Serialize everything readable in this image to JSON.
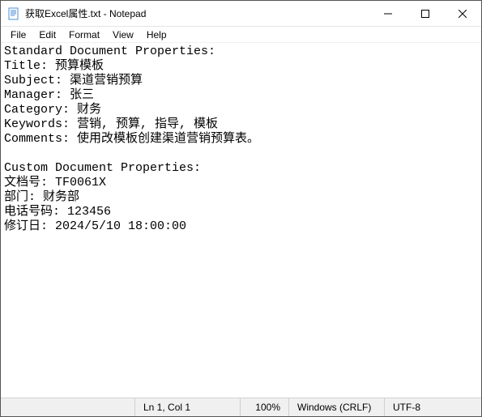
{
  "titlebar": {
    "title": "获取Excel属性.txt - Notepad",
    "icon_name": "notepad-icon"
  },
  "menubar": {
    "items": [
      {
        "label": "File"
      },
      {
        "label": "Edit"
      },
      {
        "label": "Format"
      },
      {
        "label": "View"
      },
      {
        "label": "Help"
      }
    ]
  },
  "document": {
    "lines": [
      "Standard Document Properties:",
      "Title: 预算模板",
      "Subject: 渠道营销预算",
      "Manager: 张三",
      "Category: 财务",
      "Keywords: 营销, 预算, 指导, 模板",
      "Comments: 使用改模板创建渠道营销预算表。",
      "",
      "Custom Document Properties:",
      "文档号: TF0061X",
      "部门: 财务部",
      "电话号码: 123456",
      "修订日: 2024/5/10 18:00:00"
    ]
  },
  "statusbar": {
    "position": "Ln 1, Col 1",
    "zoom": "100%",
    "line_ending": "Windows (CRLF)",
    "encoding": "UTF-8"
  }
}
